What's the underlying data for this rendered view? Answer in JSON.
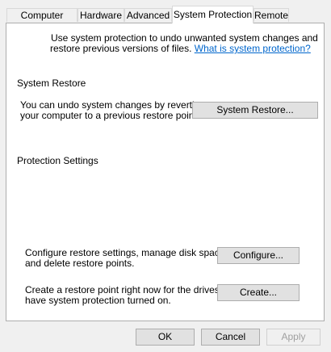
{
  "tabs": [
    "Computer Name",
    "Hardware",
    "Advanced",
    "System Protection",
    "Remote"
  ],
  "active_tab": "System Protection",
  "intro": {
    "line1": "Use system protection to undo unwanted system changes and",
    "line2": "restore previous versions of files.",
    "link": "What is system protection?"
  },
  "system_restore": {
    "heading": "System Restore",
    "line1": "You can undo system changes by reverting",
    "line2": "your computer to a previous restore point.",
    "button": "System Restore..."
  },
  "protection_settings": {
    "heading": "Protection Settings",
    "configure": {
      "line1": "Configure restore settings, manage disk space,",
      "line2": "and delete restore points.",
      "button": "Configure..."
    },
    "create": {
      "line1": "Create a restore point right now for the drives that",
      "line2": "have system protection turned on.",
      "button": "Create..."
    }
  },
  "footer": {
    "ok": "OK",
    "cancel": "Cancel",
    "apply": "Apply",
    "apply_enabled": false
  }
}
